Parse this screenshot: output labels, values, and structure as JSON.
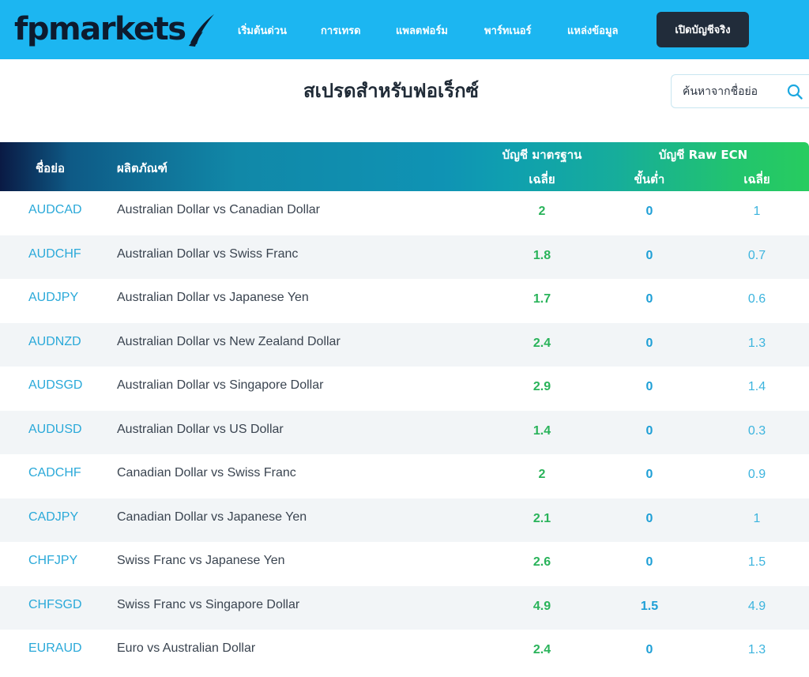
{
  "brand": {
    "name": "fpmarkets"
  },
  "nav": {
    "items": [
      "เริ่มต้นด่วน",
      "การเทรด",
      "แพลตฟอร์ม",
      "พาร์ทเนอร์",
      "แหล่งข้อมูล"
    ],
    "cta_label": "เปิดบัญชีจริง"
  },
  "page": {
    "title": "สเปรดสำหรับฟอเร็กซ์"
  },
  "search": {
    "placeholder": "ค้นหาจากชื่อย่อ"
  },
  "table": {
    "headers": {
      "symbol": "ชื่อย่อ",
      "product": "ผลิตภัณฑ์",
      "standard_account": "บัญชี มาตรฐาน",
      "standard_avg": "เฉลี่ย",
      "raw_account": "บัญชี Raw ECN",
      "raw_min": "ขั้นต่ำ",
      "raw_avg": "เฉลี่ย"
    },
    "rows": [
      {
        "symbol": "AUDCAD",
        "product": "Australian Dollar vs Canadian Dollar",
        "standard_avg": "2",
        "raw_min": "0",
        "raw_avg": "1"
      },
      {
        "symbol": "AUDCHF",
        "product": "Australian Dollar vs Swiss Franc",
        "standard_avg": "1.8",
        "raw_min": "0",
        "raw_avg": "0.7"
      },
      {
        "symbol": "AUDJPY",
        "product": "Australian Dollar vs Japanese Yen",
        "standard_avg": "1.7",
        "raw_min": "0",
        "raw_avg": "0.6"
      },
      {
        "symbol": "AUDNZD",
        "product": "Australian Dollar vs New Zealand Dollar",
        "standard_avg": "2.4",
        "raw_min": "0",
        "raw_avg": "1.3"
      },
      {
        "symbol": "AUDSGD",
        "product": "Australian Dollar vs Singapore Dollar",
        "standard_avg": "2.9",
        "raw_min": "0",
        "raw_avg": "1.4"
      },
      {
        "symbol": "AUDUSD",
        "product": "Australian Dollar vs US Dollar",
        "standard_avg": "1.4",
        "raw_min": "0",
        "raw_avg": "0.3"
      },
      {
        "symbol": "CADCHF",
        "product": "Canadian Dollar vs Swiss Franc",
        "standard_avg": "2",
        "raw_min": "0",
        "raw_avg": "0.9"
      },
      {
        "symbol": "CADJPY",
        "product": "Canadian Dollar vs Japanese Yen",
        "standard_avg": "2.1",
        "raw_min": "0",
        "raw_avg": "1"
      },
      {
        "symbol": "CHFJPY",
        "product": "Swiss Franc vs Japanese Yen",
        "standard_avg": "2.6",
        "raw_min": "0",
        "raw_avg": "1.5"
      },
      {
        "symbol": "CHFSGD",
        "product": "Swiss Franc vs Singapore Dollar",
        "standard_avg": "4.9",
        "raw_min": "1.5",
        "raw_avg": "4.9"
      },
      {
        "symbol": "EURAUD",
        "product": "Euro vs Australian Dollar",
        "standard_avg": "2.4",
        "raw_min": "0",
        "raw_avg": "1.3"
      }
    ]
  },
  "colors": {
    "nav_bg": "#1cb6f1",
    "cta_bg": "#212c3a",
    "symbol_link": "#2aa9d9",
    "standard_value": "#29b35a",
    "raw_min_value": "#1e9fd6",
    "raw_avg_value": "#3cb4de"
  },
  "icons": {
    "search": "search-icon",
    "logo": "logo-swoosh-icon"
  }
}
